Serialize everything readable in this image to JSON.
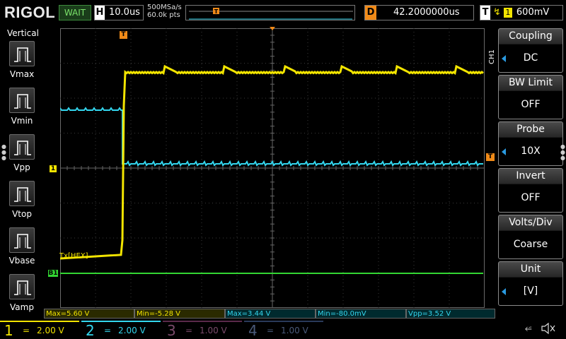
{
  "header": {
    "logo": "RIGOL",
    "status": "WAIT",
    "horizontal": {
      "label": "H",
      "value": "10.0us"
    },
    "acquisition": {
      "sample_rate": "500MSa/s",
      "memory_depth": "60.0k pts"
    },
    "trigger_marker": "T",
    "delay": {
      "label": "D",
      "value": "42.2000000us"
    },
    "trigger": {
      "label": "T",
      "edge_symbol": "↯",
      "source": "1",
      "level": "600mV"
    }
  },
  "left_panel": {
    "title": "Vertical",
    "items": [
      {
        "label": "Vmax"
      },
      {
        "label": "Vmin"
      },
      {
        "label": "Vpp"
      },
      {
        "label": "Vtop"
      },
      {
        "label": "Vbase"
      },
      {
        "label": "Vamp"
      }
    ]
  },
  "graticule": {
    "trigger_top_marker": "T",
    "ch1_marker": "1",
    "bus_marker": "B1",
    "trigger_level_marker": "T",
    "decode_label": "Tx[HEX]"
  },
  "right_menu": {
    "channel_tag": "CH1",
    "items": [
      {
        "title": "Coupling",
        "value": "DC",
        "has_arrow": true
      },
      {
        "title": "BW Limit",
        "value": "OFF",
        "has_arrow": false
      },
      {
        "title": "Probe",
        "value": "10X",
        "has_arrow": true
      },
      {
        "title": "Invert",
        "value": "OFF",
        "has_arrow": false
      },
      {
        "title": "Volts/Div",
        "value": "Coarse",
        "has_arrow": false
      },
      {
        "title": "Unit",
        "value": "[V]",
        "has_arrow": true
      }
    ]
  },
  "measurements": [
    {
      "text": "Max=5.60 V",
      "channel": 1
    },
    {
      "text": "Min=-5.28 V",
      "channel": 1
    },
    {
      "text": "Max=3.44 V",
      "channel": 2
    },
    {
      "text": "Min=-80.0mV",
      "channel": 2
    },
    {
      "text": "Vpp=3.52 V",
      "channel": 2
    }
  ],
  "channels": [
    {
      "number": "1",
      "coupling": "=",
      "scale": "2.00 V",
      "color": "#f2e400",
      "active": true
    },
    {
      "number": "2",
      "coupling": "=",
      "scale": "2.00 V",
      "color": "#33d6ee",
      "active": true
    },
    {
      "number": "3",
      "coupling": "=",
      "scale": "1.00 V",
      "color": "#7a4a6a",
      "active": false
    },
    {
      "number": "4",
      "coupling": "=",
      "scale": "1.00 V",
      "color": "#4a5a7a",
      "active": false
    }
  ],
  "status_icons": {
    "usb": "usb-icon",
    "speaker": "speaker-muted-icon"
  },
  "colors": {
    "ch1": "#f2e400",
    "ch2": "#33d6ee",
    "bus": "#33d633",
    "trigger": "#f08a18",
    "menu_arrow": "#2a9ae0"
  }
}
